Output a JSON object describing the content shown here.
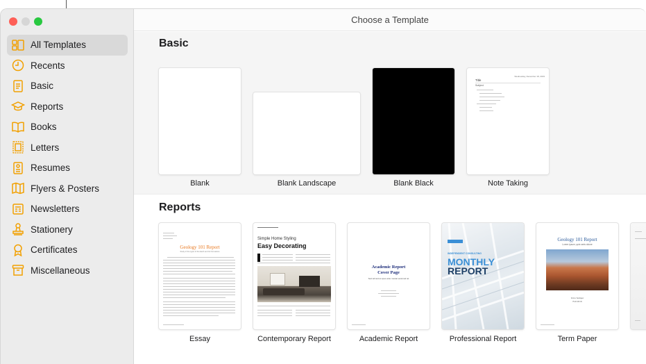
{
  "window": {
    "title": "Choose a Template"
  },
  "sidebar": {
    "items": [
      {
        "label": "All Templates",
        "icon": "grid-icon",
        "selected": true
      },
      {
        "label": "Recents",
        "icon": "clock-icon"
      },
      {
        "label": "Basic",
        "icon": "document-icon"
      },
      {
        "label": "Reports",
        "icon": "graduation-cap-icon"
      },
      {
        "label": "Books",
        "icon": "book-icon"
      },
      {
        "label": "Letters",
        "icon": "stamp-icon"
      },
      {
        "label": "Resumes",
        "icon": "resume-icon"
      },
      {
        "label": "Flyers & Posters",
        "icon": "map-icon"
      },
      {
        "label": "Newsletters",
        "icon": "newspaper-icon"
      },
      {
        "label": "Stationery",
        "icon": "stamp-person-icon"
      },
      {
        "label": "Certificates",
        "icon": "ribbon-icon"
      },
      {
        "label": "Miscellaneous",
        "icon": "archive-icon"
      }
    ]
  },
  "sections": {
    "basic": {
      "title": "Basic",
      "templates": [
        "Blank",
        "Blank Landscape",
        "Blank Black",
        "Note Taking"
      ]
    },
    "reports": {
      "title": "Reports",
      "templates": [
        "Essay",
        "Contemporary Report",
        "Academic Report",
        "Professional Report",
        "Term Paper"
      ]
    }
  },
  "thumbnails": {
    "note_taking": {
      "title": "Title",
      "date": "Wednesday, December 18, 2019",
      "subject": "Subject"
    },
    "essay": {
      "heading": "Geology 101 Report",
      "sub": "Study of the types of the Earth and Its Formations"
    },
    "contemporary": {
      "kicker": "Simple Home Styling",
      "heading": "Easy Decorating"
    },
    "academic": {
      "heading": "Academic Report",
      "sub": "Cover Page",
      "tagline": "Sed tell accus spes ante mostat euismod tet"
    },
    "professional": {
      "kicker": "INDEPENDENT CONSULTING",
      "heading1": "MONTHLY",
      "heading2": "REPORT"
    },
    "term_paper": {
      "heading": "Geology 101 Report",
      "sub": "Lorem ipsum, quis seris dolore",
      "author": "Urna Semper",
      "date": "Fall 2016"
    }
  },
  "colors": {
    "accent": "#f2a000",
    "essay_orange": "#e8761c",
    "academic_navy": "#1d2d7a",
    "professional_blue": "#3a8fd6"
  }
}
